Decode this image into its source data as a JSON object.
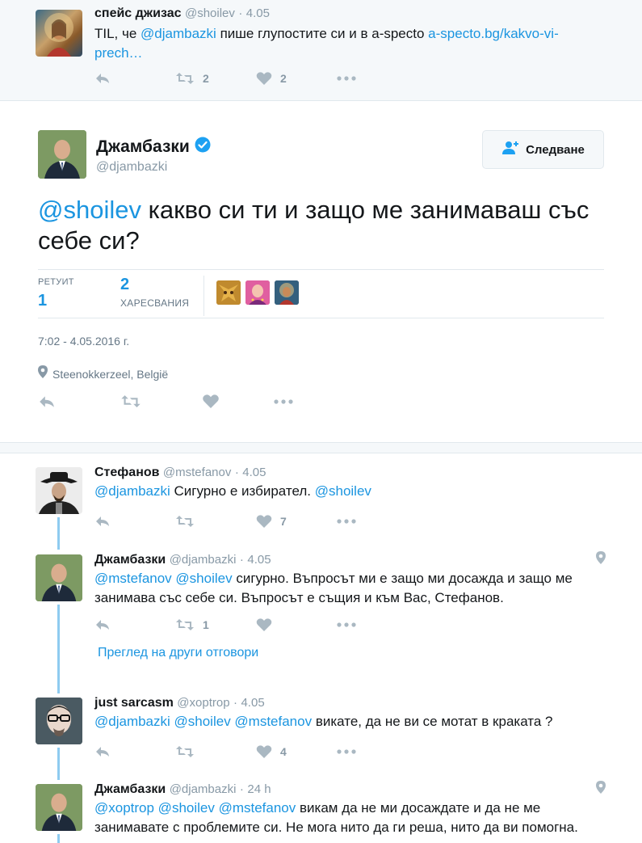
{
  "parent_tweet": {
    "name": "спейс джизас",
    "handle": "@shoilev",
    "dot": "·",
    "time": "4.05",
    "text_prefix": "TIL, че ",
    "mention": "@djambazki",
    "text_mid": " пише глупостите си и в a-specto ",
    "url_line1": "a-specto.bg/kakvo-vi-",
    "url_line2": "prech…",
    "retweets": "2",
    "likes": "2"
  },
  "main_tweet": {
    "name": "Джамбазки",
    "handle": "@djambazki",
    "follow_label": "Следване",
    "mention": "@shoilev",
    "text_rest": " какво си ти и защо ме занимаваш със себе си?",
    "retweets_label": "РЕТУИТ",
    "retweets_count": "1",
    "likes_count": "2",
    "likes_label": "ХАРЕСВАНИЯ",
    "timestamp": "7:02 - 4.05.2016 г.",
    "location": "Steenokkerzeel, België"
  },
  "replies": [
    {
      "name": "Стефанов",
      "handle": "@mstefanov",
      "dot": "·",
      "time": "4.05",
      "mentions": "@djambazki",
      "text": " Сигурно е избирател. ",
      "tail_mention": "@shoilev",
      "likes": "7"
    },
    {
      "name": "Джамбазки",
      "handle": "@djambazki",
      "dot": "·",
      "time": "4.05",
      "mentions": "@mstefanov @shoilev",
      "text_line1": " сигурно. Въпросът ми е защо ми досажда и защо ме",
      "text_line2": "занимава със себе си. Въпросът е същия и към Вас, Стефанов.",
      "retweets": "1",
      "more_replies": "Преглед на други отговори"
    },
    {
      "name": "just sarcasm",
      "handle": "@xoptrop",
      "dot": "·",
      "time": "4.05",
      "mentions": "@djambazki @shoilev @mstefanov",
      "text": " викате, да не ви се мотат в краката ?",
      "likes": "4"
    },
    {
      "name": "Джамбазки",
      "handle": "@djambazki",
      "dot": "·",
      "time": "24 h",
      "mentions": "@xoptrop @shoilev @mstefanov",
      "text_line1": " викам да не ми досаждате и да не ме",
      "text_line2": "занимавате с проблемите си. Не мога нито да ги реша, нито да ви помогна."
    }
  ]
}
